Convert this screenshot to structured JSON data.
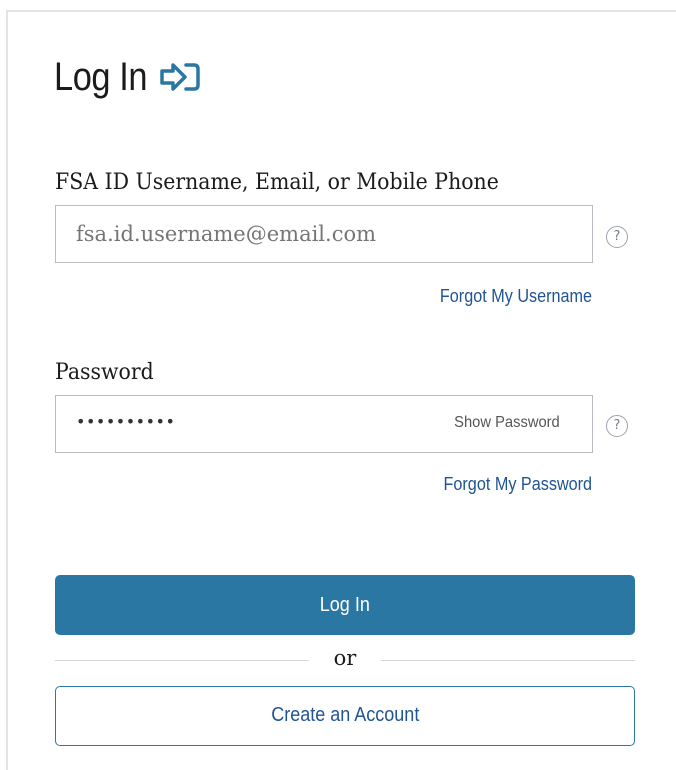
{
  "header": {
    "title": "Log In",
    "icon": "login-arrow-icon",
    "icon_color": "#2b77a4"
  },
  "username": {
    "label": "FSA ID Username, Email, or Mobile Phone",
    "placeholder": "fsa.id.username@email.com",
    "help_icon": "question-circle-icon",
    "help_glyph": "?",
    "forgot_link": "Forgot My Username"
  },
  "password": {
    "label": "Password",
    "masked_value": "••••••••••",
    "show_toggle": "Show Password",
    "help_icon": "question-circle-icon",
    "help_glyph": "?",
    "forgot_link": "Forgot My Password"
  },
  "actions": {
    "login_label": "Log In",
    "divider_text": "or",
    "create_account_label": "Create an Account"
  },
  "colors": {
    "primary": "#2b77a4",
    "link": "#205493",
    "text": "#1b1b1b",
    "border": "#b9bcc1"
  }
}
